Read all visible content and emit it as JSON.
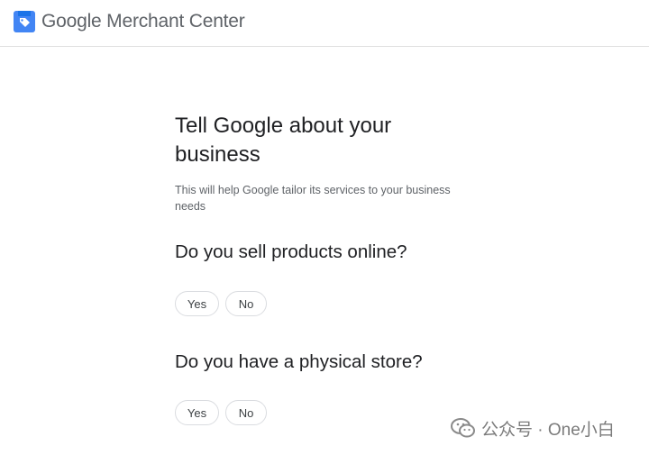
{
  "header": {
    "brand_google": "Google",
    "brand_product": "Merchant Center"
  },
  "main": {
    "title": "Tell Google about your business",
    "subtitle": "This will help Google tailor its services to your business needs",
    "questions": [
      {
        "text": "Do you sell products online?",
        "yes_label": "Yes",
        "no_label": "No"
      },
      {
        "text": "Do you have a physical store?",
        "yes_label": "Yes",
        "no_label": "No"
      }
    ]
  },
  "watermark": {
    "text": "公众号 · One小白",
    "icon": "wechat-icon"
  },
  "colors": {
    "logo_blue": "#4285f4",
    "text_primary": "#202124",
    "text_secondary": "#5f6368",
    "border": "#dadce0"
  }
}
